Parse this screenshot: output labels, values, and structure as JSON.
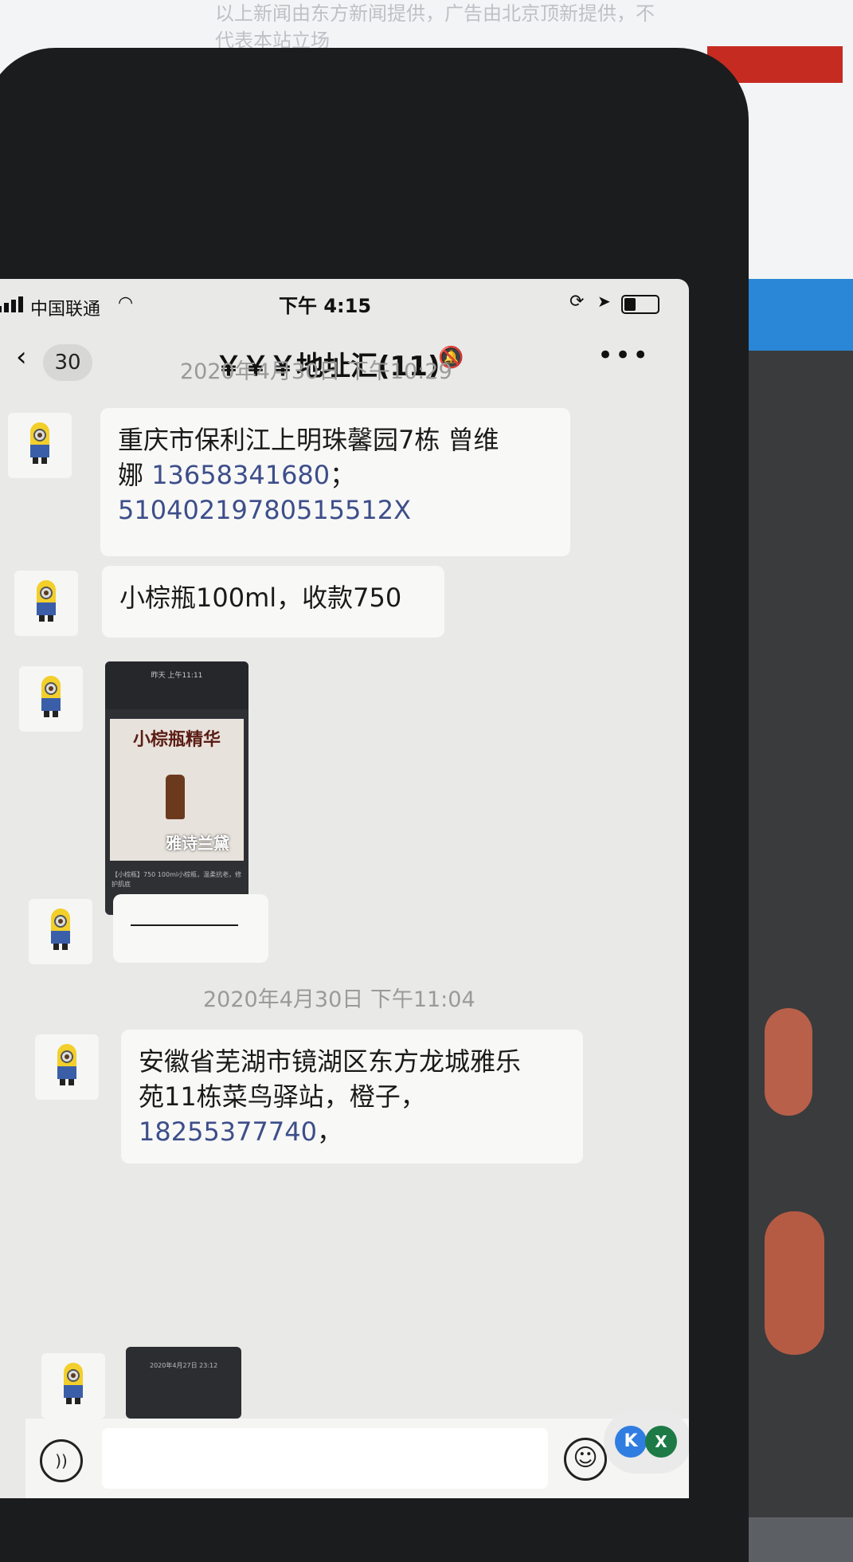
{
  "background": {
    "news_text": "以上新闻由东方新闻提供，广告由北京顶新提供，不代表本站立场"
  },
  "status_bar": {
    "carrier": "中国联通",
    "time": "下午 4:15"
  },
  "nav": {
    "unread_count": "30",
    "title": "￥￥￥地址汇(11)",
    "more": "•••"
  },
  "messages": [
    {
      "type": "timestamp",
      "text": "2020年4月30日 下午10:29"
    },
    {
      "type": "text",
      "line1": "重庆市保利江上明珠馨园7栋 曾维",
      "line2a": "娜 ",
      "line2b": "13658341680",
      "line2c": "；",
      "line3": "51040219780515512X"
    },
    {
      "type": "text",
      "text": "小棕瓶100ml，收款750"
    },
    {
      "type": "image",
      "header": "昨天 上午11:11",
      "title": "小棕瓶精华",
      "brand": "雅诗兰黛",
      "caption": "【小棕瓶】750 100ml小棕瓶，温柔抗老，修护肌底"
    },
    {
      "type": "text",
      "text": "—"
    },
    {
      "type": "timestamp",
      "text": "2020年4月30日 下午11:04"
    },
    {
      "type": "text",
      "line1": "安徽省芜湖市镜湖区东方龙城雅乐",
      "line2": "苑11栋菜鸟驿站，橙子，",
      "line3a": "18255377740",
      "line3b": "，"
    },
    {
      "type": "image",
      "header": "2020年4月27日 23:12"
    }
  ],
  "input_bar": {
    "floating_k": "K",
    "floating_x": "X"
  }
}
